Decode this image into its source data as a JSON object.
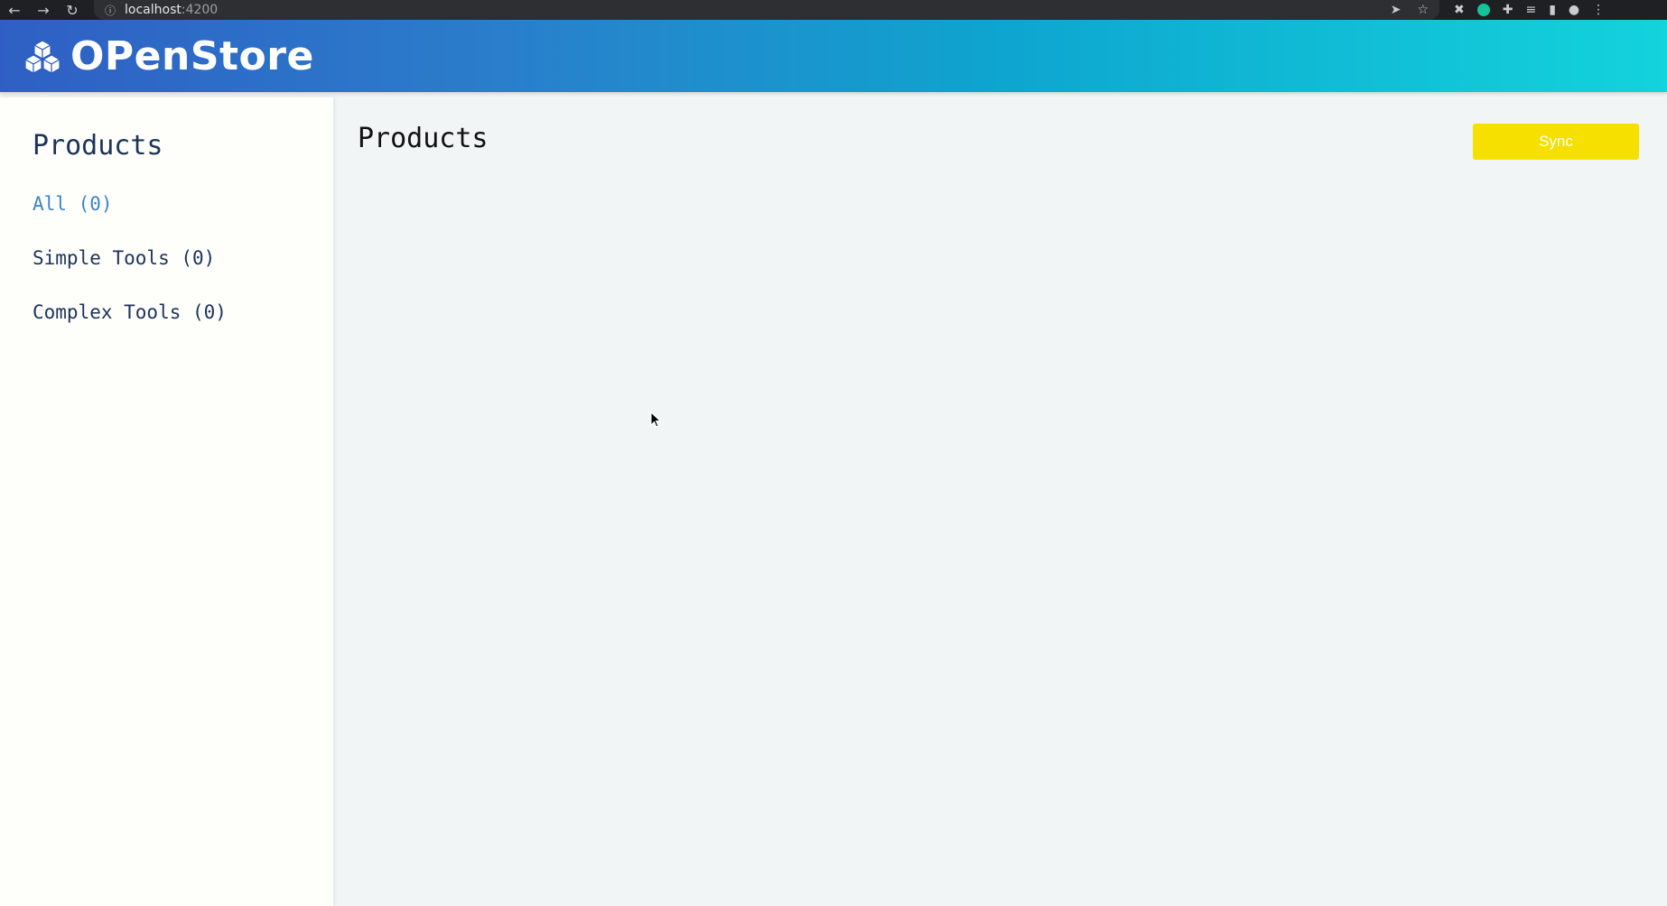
{
  "browser": {
    "back_icon": "←",
    "forward_icon": "→",
    "reload_icon": "↻",
    "info_icon": "ⓘ",
    "url_host": "localhost",
    "url_port": ":4200",
    "share_icon": "➤",
    "bookmark_icon": "☆",
    "extensions_icon": "✚",
    "queue_icon": "≡",
    "sidebar_icon": "▮",
    "menu_icon": "⋮"
  },
  "header": {
    "brand": "OPenStore",
    "brand_color": "#ffffff",
    "gradient_start": "#2f5fc4",
    "gradient_end": "#13d3dc"
  },
  "sidebar": {
    "title": "Products",
    "items": [
      {
        "label": "All (0)",
        "active": true
      },
      {
        "label": "Simple Tools (0)",
        "active": false
      },
      {
        "label": "Complex Tools (0)",
        "active": false
      }
    ],
    "active_color": "#3c86c2"
  },
  "main": {
    "title": "Products",
    "sync_label": "Sync",
    "sync_color": "#f5e000"
  }
}
